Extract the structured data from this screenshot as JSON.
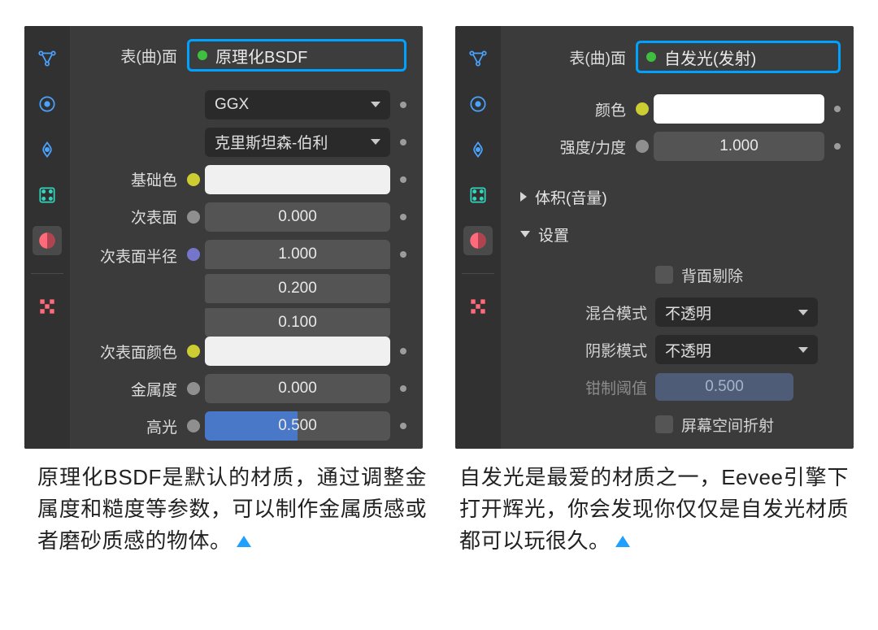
{
  "tabs": {
    "render": "render-tab",
    "output": "output-tab",
    "viewlayer": "viewlayer-tab",
    "scene": "scene-tab",
    "object": "object-tab",
    "texture": "texture-tab"
  },
  "left": {
    "surface_label": "表(曲)面",
    "shader_name": "原理化BSDF",
    "distribution": "GGX",
    "subsurface_method": "克里斯坦森-伯利",
    "base_color_label": "基础色",
    "subsurface_label": "次表面",
    "subsurface_value": "0.000",
    "subsurface_radius_label": "次表面半径",
    "subsurface_radius": [
      "1.000",
      "0.200",
      "0.100"
    ],
    "subsurface_color_label": "次表面颜色",
    "metallic_label": "金属度",
    "metallic_value": "0.000",
    "specular_label": "高光",
    "specular_value": "0.500"
  },
  "right": {
    "surface_label": "表(曲)面",
    "shader_name": "自发光(发射)",
    "color_label": "颜色",
    "strength_label": "强度/力度",
    "strength_value": "1.000",
    "volume_section": "体积(音量)",
    "settings_section": "设置",
    "backface_culling": "背面剔除",
    "blend_mode_label": "混合模式",
    "blend_mode_value": "不透明",
    "shadow_mode_label": "阴影模式",
    "shadow_mode_value": "不透明",
    "clip_threshold_label": "钳制阈值",
    "clip_threshold_value": "0.500",
    "ssr_label": "屏幕空间折射"
  },
  "captions": {
    "left": "原理化BSDF是默认的材质，通过调整金属度和糙度等参数，可以制作金属质感或者磨砂质感的物体。",
    "right": "自发光是最爱的材质之一，Eevee引擎下打开辉光，你会发现你仅仅是自发光材质都可以玩很久。"
  }
}
